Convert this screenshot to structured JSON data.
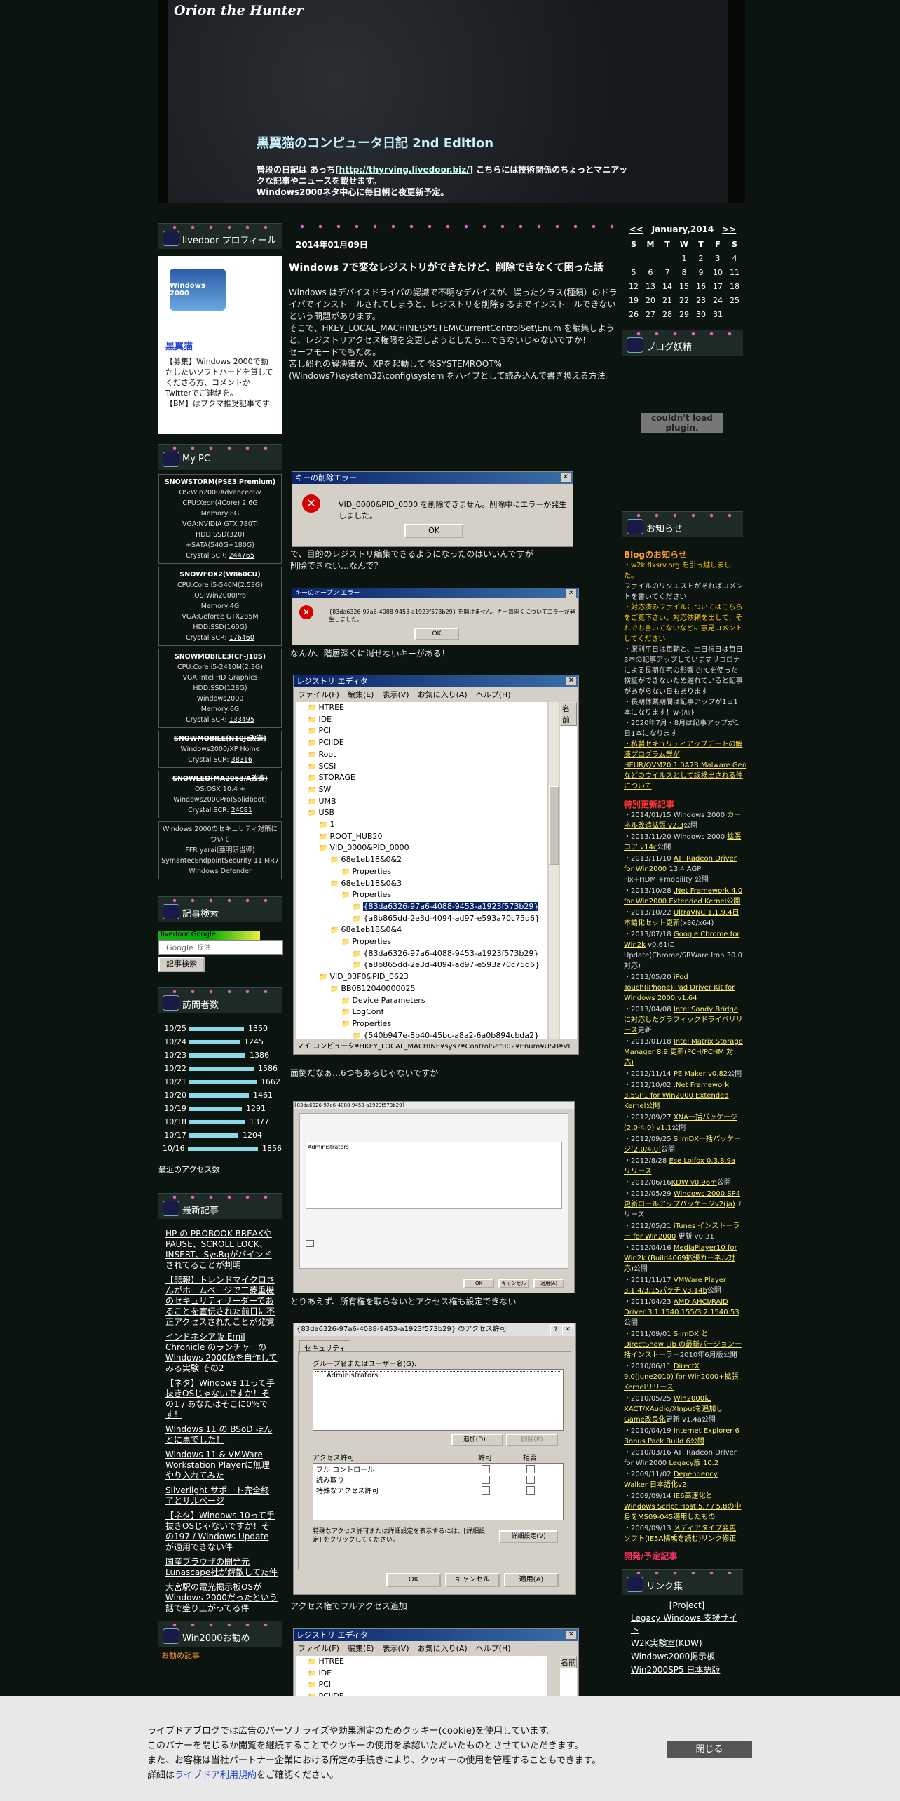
{
  "header": {
    "site_title": "Orion the Hunter",
    "blog_title": "黒翼猫のコンピュータ日記 2nd Edition",
    "desc_1": "普段の日記は あっち[",
    "desc_link": "http://thyrving.livedoor.biz/",
    "desc_2": "] こちらには技術関係のちょっとマニアックな記事やニュースを載せます。",
    "desc_3": "Windows2000ネタ中心に毎日朝と夜更新予定。"
  },
  "left": {
    "profile_head": "livedoor プロフィール",
    "profile_logo": "Windows 2000",
    "profile_name": "黒翼猫",
    "profile_text_1": "【募集】Windows 2000で動かしたいソフトハードを貸してくださる方、コメントかTwitterでご連絡を。",
    "profile_text_2": "【BM】はブクマ推奨記事です",
    "mypc_head": "My PC",
    "pcs": [
      {
        "name": "SNOWSTORM(PSE3 Premium)",
        "lines": [
          "OS:Win2000AdvancedSv",
          "CPU:Xeon(4Core) 2.6G",
          "Memory:8G",
          "VGA:NVIDIA GTX 780Ti",
          "HDD:SSD(320)",
          "+SATA(540G+180G)"
        ],
        "scr": "Crystal SCR: ",
        "scr_link": "244765"
      },
      {
        "name": "SNOWFOX2(W860CU)",
        "lines": [
          "CPU:Core i5-540M(2.53G)",
          "OS:Win2000Pro",
          "Memory:4G",
          "VGA:Geforce GTX285M",
          "HDD:SSD(160G)"
        ],
        "scr": "Crystal SCR: ",
        "scr_link": "176460"
      },
      {
        "name": "SNOWMOBILE3(CF-J10S)",
        "lines": [
          "CPU:Core i5-2410M(2.3G)",
          "VGA:Intel HD Graphics",
          "HDD:SSD(128G)",
          "Windows2000",
          "Memory:6G"
        ],
        "scr": "Crystal SCR: ",
        "scr_link": "133495"
      },
      {
        "name": "SNOWMOBILE(N10Jc改造)",
        "lines": [
          "Windows2000/XP Home"
        ],
        "scr": "Crystal SCR: ",
        "scr_link": "38316"
      },
      {
        "name": "SNOWLEO(MA2063/A改造)",
        "lines": [
          "OS:OSX 10.4 +",
          "Windows2000Pro(Solidboot)"
        ],
        "scr": "Crystal SCR: ",
        "scr_link": "24081"
      }
    ],
    "security_text": "Windows 2000のセキュリティ対策について",
    "security_lines": [
      "FFR yarai(亜明研当導)",
      "SymantecEndpointSecurity 11 MR7",
      "Windows Defender"
    ],
    "search_head": "記事検索",
    "search_logo": "Google",
    "search_placeholder": "提供",
    "search_button": "記事検索",
    "access_head": "訪問者数",
    "access_rows": [
      {
        "date": "10/25",
        "count": 1350
      },
      {
        "date": "10/24",
        "count": 1245
      },
      {
        "date": "10/23",
        "count": 1386
      },
      {
        "date": "10/22",
        "count": 1586
      },
      {
        "date": "10/21",
        "count": 1662
      },
      {
        "date": "10/20",
        "count": 1461
      },
      {
        "date": "10/19",
        "count": 1291
      },
      {
        "date": "10/18",
        "count": 1377
      },
      {
        "date": "10/17",
        "count": 1204
      },
      {
        "date": "10/16",
        "count": 1856
      }
    ],
    "recent_access": "最近のアクセス数",
    "latest_head": "最新記事",
    "latest": [
      "HP の PROBOOK BREAKやPAUSE、SCROLL LOCK、INSERT、SysRqがバインドされてることが判明",
      "【悲報】トレンドマイクロさんがホームページで三菱重機のセキュリティリーダーであることを宣伝された前日に不正アクセスされたことが発覚",
      "インドネシア版 Emil Chronicle のランチャーの Windows 2000版を自作してみる実験 その2",
      "【ネタ】Windows 11って手抜きOSじゃないですか！その1 / あなたはそこに0%です！",
      "Windows 11 の BSoD ほんとに黒でした！",
      "Windows 11 & VMWare Workstation Playerに無理やり入れてみた",
      "Silverlight サポート完全終了とサルベージ",
      "【ネタ】Windows 10って手抜きOSじゃないですか！その197 / Windows Update が適用できない件",
      "国産ブラウザの開発元 Lunascape社が解散してた件",
      "大宮駅の電光掲示板OSが Windows 2000だったという話で盛り上がってる件"
    ],
    "win2k_head": "Win2000お勧め",
    "win2k_sub": "お勧め記事"
  },
  "post": {
    "date": "2014年01月09日",
    "title": "Windows 7で変なレジストリができたけど、削除できなくて困った話",
    "p1": "Windows はデバイスドライバの認識で不明なデバイスが、誤ったクラス(種類）のドライバでインストールされてしまうと、レジストリを削除するまでインストールできないという問題があります。",
    "p2": "そこで、HKEY_LOCAL_MACHINE\\SYSTEM\\CurrentControlSet\\Enum を編集しようと、レジストリアクセス権限を変更しようとしたら…できないじゃないですか！",
    "p3": "セーフモードでもだめ。",
    "p4": "苦し紛れの解決策が、XPを起動して %SYSTEMROOT%(Windows7)\\system32\\config\\system をハイブとして読み込んで書き換える方法。",
    "dlg1_title": "キーの削除エラー",
    "dlg1_msg": "VID_0000&PID_0000 を削除できません。削除中にエラーが発生しました。",
    "ok": "OK",
    "cap1": "で、目的のレジストリ編集できるようになったのはいいんですが",
    "cap1b": "削除できない…なんで？",
    "dlg2_title": "キーのオープン エラー",
    "dlg2_msg": "{83da6326-97a6-4088-9453-a1923f573b29} を開けません。キー毎開くについてエラーが発生しました。",
    "cap2": "なんか、階層深くに消せないキーがある！",
    "reg_title": "レジストリ エディタ",
    "reg_menu": [
      "ファイル(F)",
      "編集(E)",
      "表示(V)",
      "お気に入り(A)",
      "ヘルプ(H)"
    ],
    "reg_col": "名前",
    "reg_tree": [
      "HTREE",
      "IDE",
      "PCI",
      "PCIIDE",
      "Root",
      "SCSI",
      "STORAGE",
      "SW",
      "UMB",
      "USB",
      "1",
      "ROOT_HUB20",
      "VID_0000&PID_0000",
      "68e1eb18&0&2",
      "Properties",
      "68e1eb18&0&3",
      "Properties",
      "{83da6326-97a6-4088-9453-a1923f573b29}",
      "{a8b865dd-2e3d-4094-ad97-e593a70c75d6}",
      "68e1eb18&0&4",
      "Properties",
      "{83da6326-97a6-4088-9453-a1923f573b29}",
      "{a8b865dd-2e3d-4094-ad97-e593a70c75d6}",
      "VID_03F0&PID_0623",
      "BB0812040000025",
      "Device Parameters",
      "LogConf",
      "Properties",
      "{540b947e-8b40-45bc-a8a2-6a0b894cbda2}",
      "{83da6326-97a6-4088-9453-a1923f573b29}",
      "{a8b865dd-2e3d-4094-ad97-e593a70c75d6}"
    ],
    "reg_status": "マイ コンピュータ¥HKEY_LOCAL_MACHINE¥sys7¥ControlSet002¥Enum¥USB¥VI",
    "cap3": "面倒だなぁ…6つもあるじゃないですか",
    "cap4": "とりあえず、所有権を取らないとアクセス権も設定できない",
    "perm_title": "{83da6326-97a6-4088-9453-a1923f573b29} のアクセス許可",
    "perm_tab": "セキュリティ",
    "perm_group": "グループ名またはユーザー名(G):",
    "perm_user": "Administrators",
    "perm_add": "追加(D)...",
    "perm_del": "削除(R)",
    "perm_label": "アクセス許可",
    "perm_allow": "許可",
    "perm_deny": "拒否",
    "perm_rows": [
      "フル コントロール",
      "読み取り",
      "特殊なアクセス許可"
    ],
    "perm_note": "特殊なアクセス許可または詳細設定を表示するには、[詳細設定] をクリックしてください。",
    "perm_adv": "詳細設定(V)",
    "perm_ok": "OK",
    "perm_cancel": "キャンセル",
    "perm_apply": "適用(A)",
    "cap5": "アクセス権でフルアクセス追加",
    "reg2_tree": [
      "HTREE",
      "IDE",
      "PCI",
      "PCIIDE"
    ]
  },
  "right": {
    "cal_prev": "<<",
    "cal_title": "January,2014",
    "cal_next": ">>",
    "cal_days": [
      "S",
      "M",
      "T",
      "W",
      "T",
      "F",
      "S"
    ],
    "cal_weeks": [
      [
        "",
        "",
        "",
        "1",
        "2",
        "3",
        "4"
      ],
      [
        "5",
        "6",
        "7",
        "8",
        "9",
        "10",
        "11"
      ],
      [
        "12",
        "13",
        "14",
        "15",
        "16",
        "17",
        "18"
      ],
      [
        "19",
        "20",
        "21",
        "22",
        "23",
        "24",
        "25"
      ],
      [
        "26",
        "27",
        "28",
        "29",
        "30",
        "31",
        ""
      ]
    ],
    "parts_head": "ブログ妖精",
    "plugin_error": "couldn't load plugin.",
    "notice_head": "お知らせ",
    "blog_notice_title": "Blogのお知らせ",
    "notice_lines": [
      "・w2k.flxsrv.org を引っ越しました。",
      "ファイルのリクエストがあればコメントを書いてください",
      "・対応済みファイルについてはこちらをご覧下さい。対応依頼を出して、それでも書いてないなどに意見コメントしてください",
      "・原則平日は毎朝と、土日祝日は毎日3本の記事アップしていますリコロナによる長期在宅の影響でPCを使った検証ができないため遅れていると記事があがらない日もあります",
      "・長期休業期間は記事アップが1日1本になります！w-)ﾊｯﾄ",
      "・2020年7月・8月は記事アップが1日1本になります"
    ],
    "notice_link": "・私製セキュリティアップデートの解凍プログラム群が HEUR/QVM20.1.0A7B.Malware.Gen などのウイルスとして誤検出される件について",
    "special_title": "特別更新記事",
    "updates": [
      [
        "・2014/01/15 Windows 2000 ",
        "カーネル改造拡張 v2.3",
        "公開"
      ],
      [
        "・2013/11/20 Windows 2000 ",
        "拡張コア v14c",
        "公開"
      ],
      [
        "・2013/11/10 ",
        "ATI Radeon Driver for Win2000",
        " 13.4 AGP Fix+HDMI+mobility 公開"
      ],
      [
        "・2013/10/28 ",
        ".Net Framework 4.0 for Win2000 Extended Kernel公開",
        ""
      ],
      [
        "・2013/10/22 ",
        "UltraVNC 1.1.9.4日本語化セット更新",
        "(x86/x64)"
      ],
      [
        "・2013/07/18 ",
        "Google Chrome for Win2k",
        " v0.61に Update(Chrome/SRWare Iron 30.0 対応)"
      ],
      [
        "・2013/05/20 ",
        "iPod Touch(iPhone)iPad Driver Kit for Windows 2000 v1.64",
        ""
      ],
      [
        "・2013/04/08 ",
        "Intel Sandy Bridgeに対応したグラフィックドライバリリース",
        "更新"
      ],
      [
        "・2013/01/18 ",
        "Intel Matrix Storage Manager 8.9 更新(PCH/PCHM 対応)",
        ""
      ],
      [
        "・2012/11/14 ",
        "PE Maker v0.82",
        "公開"
      ],
      [
        "・2012/10/02 ",
        ".Net Framework 3.5SP1 for Win2000 Extended Kernel公開",
        ""
      ],
      [
        "・2012/09/27 ",
        "XNA一括パッケージ(2.0-4.0) v1.1",
        "公開"
      ],
      [
        "・2012/09/25 ",
        "SlimDX一括パッケージ(2.0/4.0)",
        "公開"
      ],
      [
        "・2012/8/28 ",
        "Ese Lolfox 0.3.8.9a リリース",
        ""
      ],
      [
        "・2012/06/16",
        "KDW v0.96m",
        "公開"
      ],
      [
        "・2012/05/29 ",
        "Windows 2000 SP4 更新ロールアップパッケージv2(ja)",
        "リリース"
      ],
      [
        "・2012/05/21 ",
        "iTunes インストーラー for Win2000",
        " 更新 v0.31"
      ],
      [
        "・2012/04/16 ",
        "MediaPlayer10 for Win2k (Build4069拡張カーネル対応)",
        "公開"
      ],
      [
        "・2011/11/17 ",
        "VMWare Player 3.1.4/3.15パッチ v3.14b",
        "公開"
      ],
      [
        "・2011/04/23 ",
        "AMD AHCI/RAID Driver 3.1.1540.155/3.2.1540.53",
        "公開"
      ],
      [
        "・2011/09/01 ",
        "SlimDX とDirectShow Lib の最新バージョン一括インストーラー",
        "2010年6月版公開"
      ],
      [
        "・2010/06/11 ",
        "DirectX 9.0(June2010) for Win2000+拡張Kernelリリース",
        ""
      ],
      [
        "・2010/05/25 ",
        "Win2000にXACT/XAudio/XInputを追加しGame改良化",
        "更新 v1.4a公開"
      ],
      [
        "・2010/04/19 ",
        "Internet Explorer 6 Bonus Pack Build 6公開",
        ""
      ],
      [
        "・2010/03/16 ATI Radeon Driver for Win2000 ",
        "Legacy版 10.2",
        ""
      ],
      [
        "・2009/11/02 ",
        "Dependency Walker 日本語化v2",
        ""
      ],
      [
        "・2009/09/14 ",
        "IE6高速化とWindows Script Host 5.7 / 5.8の中身をMS09-045適用したもの",
        ""
      ],
      [
        "・2009/09/13 ",
        "メディアタイプ変更ソフト(IE5A構成を読む)リンク修正",
        ""
      ]
    ],
    "dev_title": "開発/予定記事",
    "links_head": "リンク集",
    "links_project": "[Project]",
    "links": [
      "Legacy Windows 支援サイト",
      "W2K実験室(KDW)",
      "Windows2000掲示板",
      "Win2000SP5 日本語版"
    ]
  },
  "cookie": {
    "line1": "ライブドアブログでは広告のパーソナライズや効果測定のためクッキー(cookie)を使用しています。",
    "line2": "このバナーを閉じるか閲覧を継続することでクッキーの使用を承認いただいたものとさせていただきます。",
    "line3": "また、お客様は当社パートナー企業における所定の手続きにより、クッキーの使用を管理することもできます。",
    "line4a": "詳細は",
    "line4_link": "ライブドア利用規約",
    "line4b": "をご確認ください。",
    "close": "閉じる"
  }
}
